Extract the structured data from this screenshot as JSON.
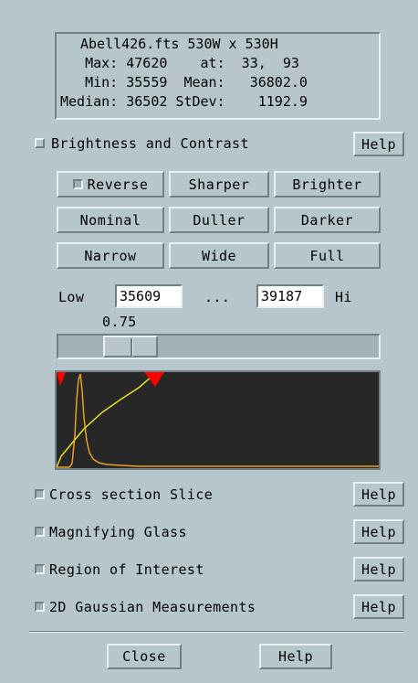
{
  "info": {
    "line1": "Abell426.fts 530W x 530H",
    "line2": "   Max: 47620    at:  33,  93",
    "line3": "   Min: 35559  Mean:   36802.0",
    "line4": "Median: 36502 StDev:    1192.9"
  },
  "brightness": {
    "title": "Brightness and Contrast",
    "help": "Help",
    "reverse": "Reverse",
    "sharper": "Sharper",
    "brighter": "Brighter",
    "nominal": "Nominal",
    "duller": "Duller",
    "darker": "Darker",
    "narrow": "Narrow",
    "wide": "Wide",
    "full": "Full",
    "low_label": "Low",
    "low_value": "35609",
    "ellipsis": "...",
    "hi_value": "39187",
    "hi_label": "Hi",
    "contrast_value": "0.75",
    "slider_fraction": 0.17
  },
  "sections": [
    {
      "label": "Cross section Slice",
      "help": "Help"
    },
    {
      "label": "Magnifying Glass",
      "help": "Help"
    },
    {
      "label": "Region of Interest",
      "help": "Help"
    },
    {
      "label": "2D Gaussian Measurements",
      "help": "Help"
    }
  ],
  "footer": {
    "close": "Close",
    "help": "Help"
  },
  "colors": {
    "background": "#b6c6cb",
    "histogram_bg": "#272727",
    "histogram_curve": "#e8a020",
    "transfer_curve": "#e8e020",
    "marker": "#ff0000"
  }
}
